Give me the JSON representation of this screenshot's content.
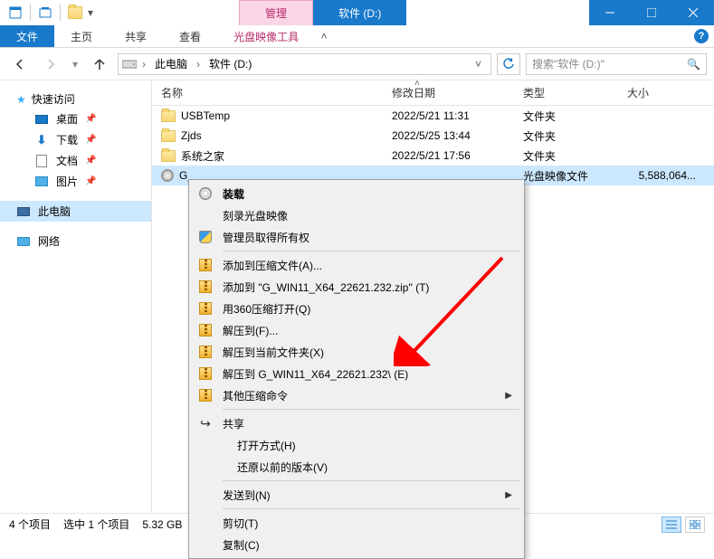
{
  "titlebar": {
    "context_tab": "管理",
    "drive_tab": "软件 (D:)"
  },
  "ribbon": {
    "file": "文件",
    "tabs": [
      "主页",
      "共享",
      "查看"
    ],
    "tool_tab": "光盘映像工具"
  },
  "breadcrumb": {
    "root": "此电脑",
    "drive": "软件 (D:)"
  },
  "search": {
    "placeholder": "搜索\"软件 (D:)\""
  },
  "columns": {
    "name": "名称",
    "date": "修改日期",
    "type": "类型",
    "size": "大小"
  },
  "rows": [
    {
      "name": "USBTemp",
      "date": "2022/5/21 11:31",
      "type": "文件夹",
      "size": "",
      "icon": "folder"
    },
    {
      "name": "Zjds",
      "date": "2022/5/25 13:44",
      "type": "文件夹",
      "size": "",
      "icon": "folder"
    },
    {
      "name": "系统之家",
      "date": "2022/5/21 17:56",
      "type": "文件夹",
      "size": "",
      "icon": "folder"
    },
    {
      "name": "G_",
      "date": "",
      "type": "光盘映像文件",
      "size": "5,588,064...",
      "icon": "iso",
      "selected": true
    }
  ],
  "sidebar": {
    "quick_access": "快速访问",
    "items": [
      {
        "label": "桌面",
        "icon": "desktop",
        "pinned": true
      },
      {
        "label": "下载",
        "icon": "download",
        "pinned": true
      },
      {
        "label": "文档",
        "icon": "document",
        "pinned": true
      },
      {
        "label": "图片",
        "icon": "picture",
        "pinned": true
      }
    ],
    "this_pc": "此电脑",
    "network": "网络"
  },
  "context_menu": {
    "items": [
      {
        "label": "装载",
        "icon": "disc",
        "default": true
      },
      {
        "label": "刻录光盘映像",
        "icon": ""
      },
      {
        "label": "管理员取得所有权",
        "icon": "shield"
      },
      {
        "sep": true
      },
      {
        "label": "添加到压缩文件(A)...",
        "icon": "zip"
      },
      {
        "label": "添加到 \"G_WIN11_X64_22621.232.zip\" (T)",
        "icon": "zip"
      },
      {
        "label": "用360压缩打开(Q)",
        "icon": "zip"
      },
      {
        "label": "解压到(F)...",
        "icon": "zip"
      },
      {
        "label": "解压到当前文件夹(X)",
        "icon": "zip"
      },
      {
        "label": "解压到 G_WIN11_X64_22621.232\\ (E)",
        "icon": "zip"
      },
      {
        "label": "其他压缩命令",
        "icon": "zip",
        "submenu": true
      },
      {
        "sep": true
      },
      {
        "label": "共享",
        "icon": "share"
      },
      {
        "label": "打开方式(H)",
        "icon": "",
        "indent": true
      },
      {
        "label": "还原以前的版本(V)",
        "icon": "",
        "indent": true
      },
      {
        "sep": true
      },
      {
        "label": "发送到(N)",
        "icon": "",
        "submenu": true
      },
      {
        "sep": true
      },
      {
        "label": "剪切(T)",
        "icon": ""
      },
      {
        "label": "复制(C)",
        "icon": ""
      }
    ]
  },
  "status": {
    "count": "4 个项目",
    "selection": "选中 1 个项目",
    "size": "5.32 GB"
  }
}
